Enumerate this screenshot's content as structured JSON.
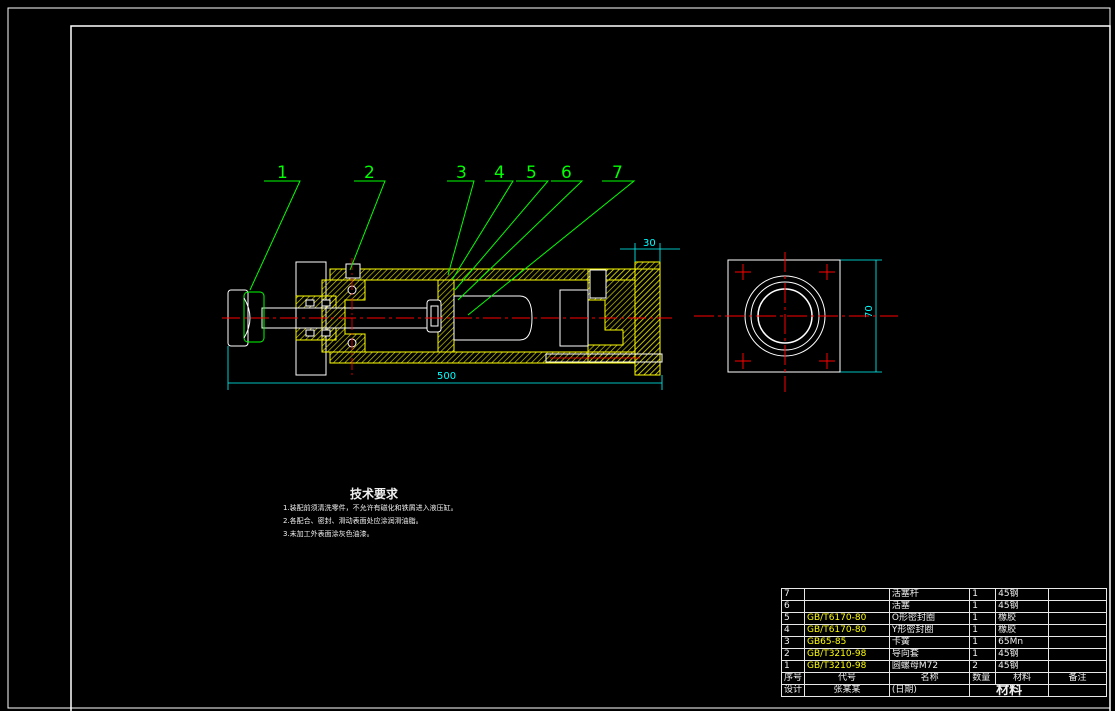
{
  "callouts": [
    "1",
    "2",
    "3",
    "4",
    "5",
    "6",
    "7"
  ],
  "dimensions": {
    "overall_length": "500",
    "flange_width": "30",
    "end_view_height": "70"
  },
  "tech_notes": {
    "title": "技术要求",
    "lines": [
      "1.装配前须清洗零件，不允许有磁化和铁屑进入液压缸。",
      "2.各配合、密封、滑动表面处应涂润滑油脂。",
      "3.未加工外表面涂灰色油漆。"
    ]
  },
  "bom": {
    "rows": [
      {
        "no": "7",
        "code": "",
        "name": "活塞杆",
        "qty": "1",
        "material": "45钢",
        "note": ""
      },
      {
        "no": "6",
        "code": "",
        "name": "活塞",
        "qty": "1",
        "material": "45钢",
        "note": ""
      },
      {
        "no": "5",
        "code": "GB/T6170-80",
        "name": "O形密封圈",
        "qty": "1",
        "material": "橡胶",
        "note": ""
      },
      {
        "no": "4",
        "code": "GB/T6170-80",
        "name": "Y形密封圈",
        "qty": "1",
        "material": "橡胶",
        "note": ""
      },
      {
        "no": "3",
        "code": "GB65-85",
        "name": "卡簧",
        "qty": "1",
        "material": "65Mn",
        "note": ""
      },
      {
        "no": "2",
        "code": "GB/T3210-98",
        "name": "导向套",
        "qty": "1",
        "material": "45钢",
        "note": ""
      },
      {
        "no": "1",
        "code": "GB/T3210-98",
        "name": "圆螺母M72",
        "qty": "2",
        "material": "45钢",
        "note": ""
      }
    ],
    "header": {
      "no": "序号",
      "code": "代号",
      "name": "名称",
      "qty": "数量",
      "material": "材料",
      "note": "备注"
    },
    "footer": {
      "designer_label": "设计",
      "designer_name": "张某某",
      "date_label": "(日期)",
      "material_label": "材料"
    }
  },
  "colors": {
    "background": "#000000",
    "frame": "#ffffff",
    "outline": "#ffff00",
    "callout": "#00ff00",
    "centerline": "#ff0000",
    "dimension": "#00ffff",
    "hatch": "#ffff00"
  }
}
